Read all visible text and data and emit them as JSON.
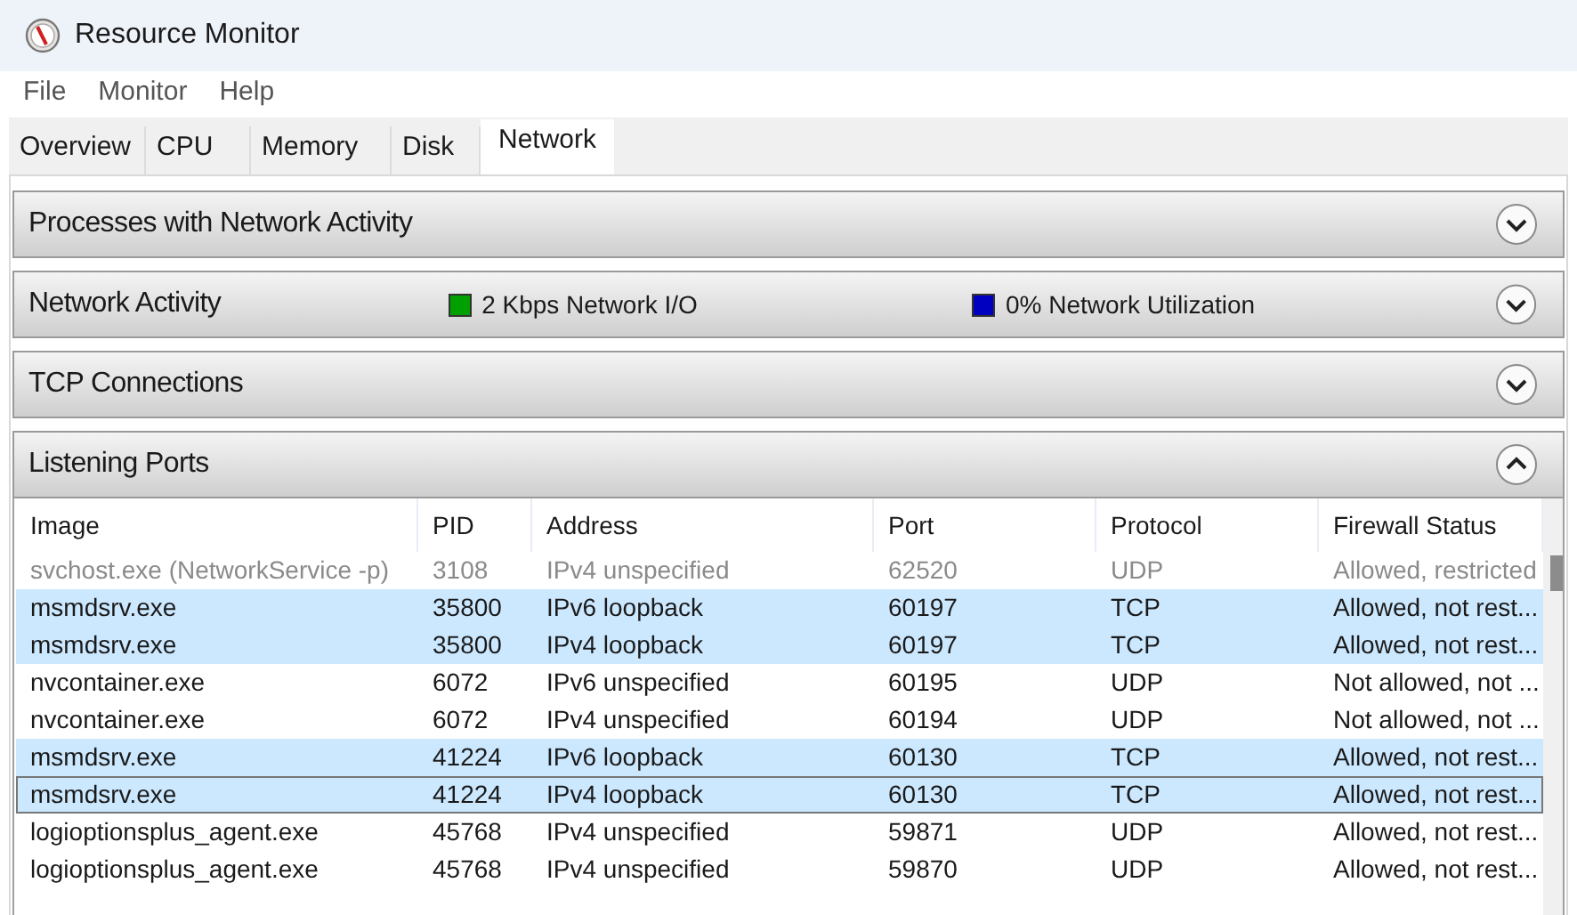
{
  "window": {
    "title": "Resource Monitor"
  },
  "menu": [
    "File",
    "Monitor",
    "Help"
  ],
  "tabs": [
    {
      "label": "Overview",
      "selected": false
    },
    {
      "label": "CPU",
      "selected": false
    },
    {
      "label": "Memory",
      "selected": false
    },
    {
      "label": "Disk",
      "selected": false
    },
    {
      "label": "Network",
      "selected": true
    }
  ],
  "sections": [
    {
      "title": "Processes with Network Activity",
      "expanded": false
    },
    {
      "title": "Network Activity",
      "expanded": false,
      "indicators": [
        {
          "label": "2 Kbps Network I/O",
          "color": "#00a000"
        },
        {
          "label": "0% Network Utilization",
          "color": "#0000c0"
        }
      ]
    },
    {
      "title": "TCP Connections",
      "expanded": false
    },
    {
      "title": "Listening Ports",
      "expanded": true
    }
  ],
  "table": {
    "columns": [
      "Image",
      "PID",
      "Address",
      "Port",
      "Protocol",
      "Firewall Status"
    ],
    "rows": [
      {
        "cells": [
          "svchost.exe (NetworkService -p)",
          "3108",
          "IPv4 unspecified",
          "62520",
          "UDP",
          "Allowed, restricted"
        ],
        "dimmed": true,
        "selected": false,
        "focused": false
      },
      {
        "cells": [
          "msmdsrv.exe",
          "35800",
          "IPv6 loopback",
          "60197",
          "TCP",
          "Allowed, not rest..."
        ],
        "dimmed": false,
        "selected": true,
        "focused": false
      },
      {
        "cells": [
          "msmdsrv.exe",
          "35800",
          "IPv4 loopback",
          "60197",
          "TCP",
          "Allowed, not rest..."
        ],
        "dimmed": false,
        "selected": true,
        "focused": false
      },
      {
        "cells": [
          "nvcontainer.exe",
          "6072",
          "IPv6 unspecified",
          "60195",
          "UDP",
          "Not allowed, not ..."
        ],
        "dimmed": false,
        "selected": false,
        "focused": false
      },
      {
        "cells": [
          "nvcontainer.exe",
          "6072",
          "IPv4 unspecified",
          "60194",
          "UDP",
          "Not allowed, not ..."
        ],
        "dimmed": false,
        "selected": false,
        "focused": false
      },
      {
        "cells": [
          "msmdsrv.exe",
          "41224",
          "IPv6 loopback",
          "60130",
          "TCP",
          "Allowed, not rest..."
        ],
        "dimmed": false,
        "selected": true,
        "focused": false
      },
      {
        "cells": [
          "msmdsrv.exe",
          "41224",
          "IPv4 loopback",
          "60130",
          "TCP",
          "Allowed, not rest..."
        ],
        "dimmed": false,
        "selected": true,
        "focused": true
      },
      {
        "cells": [
          "logioptionsplus_agent.exe",
          "45768",
          "IPv4 unspecified",
          "59871",
          "UDP",
          "Allowed, not rest..."
        ],
        "dimmed": false,
        "selected": false,
        "focused": false
      },
      {
        "cells": [
          "logioptionsplus_agent.exe",
          "45768",
          "IPv4 unspecified",
          "59870",
          "UDP",
          "Allowed, not rest..."
        ],
        "dimmed": false,
        "selected": false,
        "focused": false
      }
    ]
  }
}
